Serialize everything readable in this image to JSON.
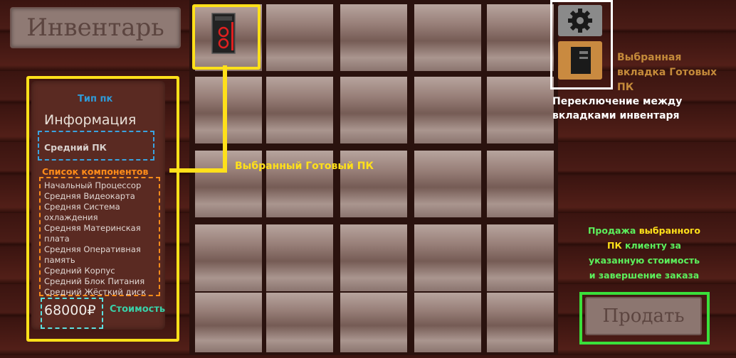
{
  "header": {
    "inventory_title": "Инвентарь"
  },
  "info_panel": {
    "type_tag": "Тип пк",
    "title": "Информация",
    "pc_type": "Средний ПК",
    "components_tag": "Список компонентов",
    "components": [
      "Начальный Процессор",
      "Средняя Видеокарта",
      "Средняя Система\nохлаждения",
      "Средняя Материнская\nплата",
      "Средняя Оперативная\nпамять",
      "Средний Корпус",
      "Средний Блок Питания",
      "Средний Жёсткий диск"
    ],
    "price": "68000₽",
    "price_tag": "Стоимость"
  },
  "grid": {
    "selected_item_label": "Выбранный  Готовый  ПК",
    "selected_item_icon": "pc-case-icon"
  },
  "tabs": {
    "items": [
      {
        "icon": "gear-icon",
        "active": false
      },
      {
        "icon": "pc-case-icon",
        "active": true
      }
    ],
    "selected_label": "Выбранная\nвкладка Готовых ПК",
    "switch_label": "Переключение между\nвкладками инвентаря"
  },
  "sell": {
    "desc_line1_green": "Продажа ",
    "desc_line1_yellow": "выбранного",
    "desc_line2_yellow": "ПК ",
    "desc_line2_green": "клиенту за",
    "desc_line3": "указанную стоимость",
    "desc_line4": "и завершение заказа",
    "button_label": "Продать"
  },
  "colors": {
    "highlight_yellow": "#ffe01a",
    "highlight_green": "#3ae03a",
    "tag_blue": "#2f9bd8",
    "tag_orange": "#ff8c1a"
  }
}
